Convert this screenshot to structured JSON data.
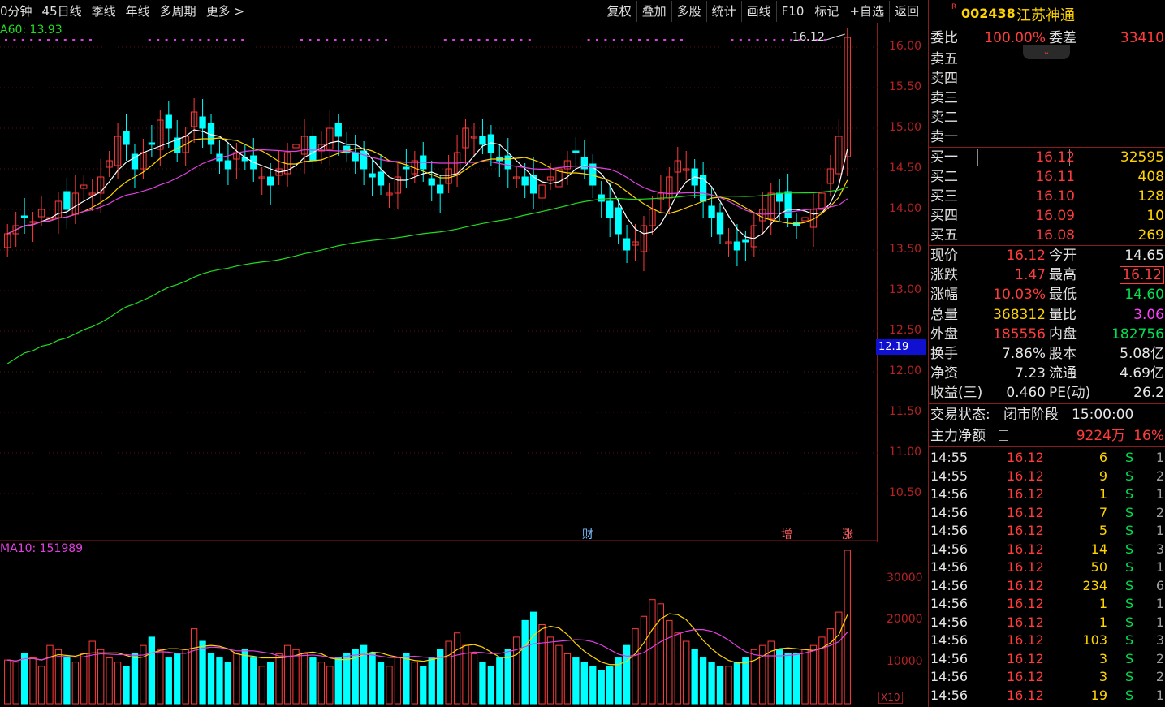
{
  "toolbar": {
    "periods": [
      "0分钟",
      "45日线",
      "季线",
      "年线",
      "多周期",
      "更多 >"
    ],
    "actions": [
      "复权",
      "叠加",
      "多股",
      "统计",
      "画线",
      "F10",
      "标记",
      "+自选",
      "返回"
    ]
  },
  "indicator": {
    "ma60_label": "A60: 13.93",
    "high_annotation": "16.12",
    "vol_ma_label": "MA10: 151989",
    "current_price_tag": "12.19",
    "volume_scale": "X10",
    "event_markers": [
      "财",
      "增",
      "涨"
    ]
  },
  "stock": {
    "code": "002438",
    "name": "江苏神通",
    "flag": "R"
  },
  "order_book": {
    "wei_bi_label": "委比",
    "wei_bi": "100.00%",
    "wei_cha_label": "委差",
    "wei_cha": "33410",
    "sells": [
      {
        "label": "卖五"
      },
      {
        "label": "卖四"
      },
      {
        "label": "卖三"
      },
      {
        "label": "卖二"
      },
      {
        "label": "卖一"
      }
    ],
    "buys": [
      {
        "label": "买一",
        "price": "16.12",
        "volume": "32595"
      },
      {
        "label": "买二",
        "price": "16.11",
        "volume": "408"
      },
      {
        "label": "买三",
        "price": "16.10",
        "volume": "128"
      },
      {
        "label": "买四",
        "price": "16.09",
        "volume": "10"
      },
      {
        "label": "买五",
        "price": "16.08",
        "volume": "269"
      }
    ]
  },
  "quote": [
    {
      "l1": "现价",
      "v1": "16.12",
      "c1": "red",
      "l2": "今开",
      "v2": "14.65",
      "c2": "white"
    },
    {
      "l1": "涨跌",
      "v1": "1.47",
      "c1": "red",
      "l2": "最高",
      "v2": "16.12",
      "c2": "red"
    },
    {
      "l1": "涨幅",
      "v1": "10.03%",
      "c1": "red",
      "l2": "最低",
      "v2": "14.60",
      "c2": "green"
    },
    {
      "l1": "总量",
      "v1": "368312",
      "c1": "yellow",
      "l2": "量比",
      "v2": "3.06",
      "c2": "mag"
    },
    {
      "l1": "外盘",
      "v1": "185556",
      "c1": "red",
      "l2": "内盘",
      "v2": "182756",
      "c2": "green"
    },
    {
      "l1": "换手",
      "v1": "7.86%",
      "c1": "white",
      "l2": "股本",
      "v2": "5.08亿",
      "c2": "white"
    },
    {
      "l1": "净资",
      "v1": "7.23",
      "c1": "white",
      "l2": "流通",
      "v2": "4.69亿",
      "c2": "white"
    },
    {
      "l1": "收益(三)",
      "v1": "0.460",
      "c1": "white",
      "l2": "PE(动)",
      "v2": "26.2",
      "c2": "white"
    }
  ],
  "status": {
    "label": "交易状态:",
    "value": "闭市阶段",
    "time": "15:00:00"
  },
  "main_force": {
    "label": "主力净额",
    "value": "9224万",
    "pct": "16%"
  },
  "ticks": [
    {
      "t": "14:55",
      "p": "16.12",
      "q": "6",
      "s": "S",
      "n": "1"
    },
    {
      "t": "14:55",
      "p": "16.12",
      "q": "9",
      "s": "S",
      "n": "2"
    },
    {
      "t": "14:56",
      "p": "16.12",
      "q": "1",
      "s": "S",
      "n": "1"
    },
    {
      "t": "14:56",
      "p": "16.12",
      "q": "7",
      "s": "S",
      "n": "2"
    },
    {
      "t": "14:56",
      "p": "16.12",
      "q": "5",
      "s": "S",
      "n": "1"
    },
    {
      "t": "14:56",
      "p": "16.12",
      "q": "14",
      "s": "S",
      "n": "3"
    },
    {
      "t": "14:56",
      "p": "16.12",
      "q": "50",
      "s": "S",
      "n": "1"
    },
    {
      "t": "14:56",
      "p": "16.12",
      "q": "234",
      "s": "S",
      "n": "6"
    },
    {
      "t": "14:56",
      "p": "16.12",
      "q": "1",
      "s": "S",
      "n": "1"
    },
    {
      "t": "14:56",
      "p": "16.12",
      "q": "1",
      "s": "S",
      "n": "1"
    },
    {
      "t": "14:56",
      "p": "16.12",
      "q": "103",
      "s": "S",
      "n": "3"
    },
    {
      "t": "14:56",
      "p": "16.12",
      "q": "3",
      "s": "S",
      "n": "2"
    },
    {
      "t": "14:56",
      "p": "16.12",
      "q": "3",
      "s": "S",
      "n": "2"
    },
    {
      "t": "14:56",
      "p": "16.12",
      "q": "19",
      "s": "S",
      "n": "1"
    }
  ],
  "colors": {
    "up": "#ff3b3b",
    "down": "#00ffff",
    "ma5": "#ffffff",
    "ma10": "#ffd400",
    "ma20": "#e040e0",
    "ma60": "#22dd22",
    "grid": "#8a1c1c"
  },
  "chart_data": {
    "type": "candlestick",
    "price_axis": {
      "ticks": [
        10.5,
        11.0,
        11.5,
        12.0,
        12.5,
        13.0,
        13.5,
        14.0,
        14.5,
        15.0,
        15.5,
        16.0
      ],
      "range": [
        10.0,
        16.3
      ]
    },
    "volume_axis": {
      "ticks": [
        10000,
        20000,
        30000
      ],
      "range": [
        0,
        38000
      ]
    },
    "close_approx": [
      13.7,
      13.8,
      13.9,
      13.85,
      14.0,
      13.9,
      14.1,
      14.0,
      14.2,
      14.3,
      14.2,
      14.4,
      14.6,
      14.9,
      14.8,
      14.5,
      14.7,
      14.8,
      15.1,
      15.0,
      14.7,
      14.9,
      15.2,
      15.0,
      14.8,
      14.6,
      14.5,
      14.7,
      14.6,
      14.5,
      14.4,
      14.3,
      14.5,
      14.7,
      14.8,
      14.9,
      14.6,
      14.8,
      15.0,
      14.9,
      14.7,
      14.6,
      14.5,
      14.4,
      14.3,
      14.2,
      14.4,
      14.5,
      14.6,
      14.5,
      14.3,
      14.2,
      14.5,
      14.7,
      15.0,
      14.9,
      14.8,
      14.7,
      14.6,
      14.5,
      14.4,
      14.3,
      14.2,
      14.3,
      14.4,
      14.5,
      14.6,
      14.7,
      14.5,
      14.3,
      14.1,
      13.9,
      13.7,
      13.5,
      13.6,
      13.8,
      14.0,
      14.2,
      14.4,
      14.6,
      14.5,
      14.3,
      14.1,
      13.9,
      13.7,
      13.6,
      13.5,
      13.6,
      13.8,
      14.0,
      14.2,
      14.1,
      13.9,
      13.8,
      13.9,
      14.0,
      14.2,
      14.5,
      14.9,
      16.12
    ],
    "volume_approx_hundreds_lots": [
      10500,
      10000,
      12000,
      11000,
      9000,
      14000,
      13000,
      11000,
      10000,
      12000,
      15000,
      13000,
      11000,
      10000,
      9000,
      12000,
      14000,
      16000,
      13000,
      11000,
      12000,
      13000,
      18000,
      15000,
      12000,
      11000,
      10000,
      12000,
      13000,
      11000,
      9000,
      10000,
      12000,
      14000,
      13000,
      12000,
      11000,
      10000,
      9000,
      11000,
      12000,
      13000,
      14000,
      12000,
      10000,
      9000,
      11000,
      12000,
      10000,
      9000,
      11000,
      13000,
      15000,
      17000,
      14000,
      12000,
      10000,
      9000,
      11000,
      13000,
      16000,
      20000,
      22000,
      19000,
      16000,
      14000,
      12000,
      11000,
      10000,
      9000,
      8000,
      9000,
      11000,
      14000,
      18000,
      21000,
      25000,
      24000,
      20000,
      17000,
      15000,
      13000,
      11000,
      10000,
      9000,
      9000,
      10000,
      11000,
      13000,
      14000,
      15000,
      13000,
      12000,
      12000,
      13000,
      14000,
      16000,
      18000,
      22000,
      36831
    ]
  }
}
